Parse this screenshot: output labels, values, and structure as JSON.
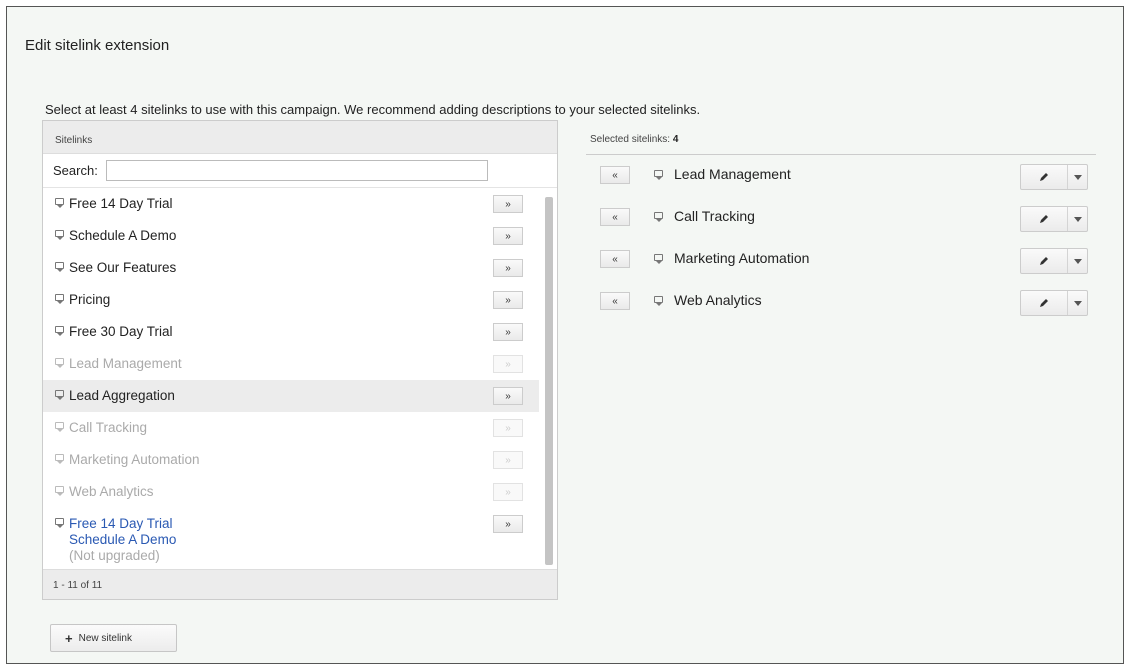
{
  "dialog": {
    "title": "Edit sitelink extension",
    "instructions": "Select at least 4 sitelinks to use with this campaign. We recommend adding descriptions to your selected sitelinks."
  },
  "sitelinks": {
    "header": "Sitelinks",
    "search_label": "Search:",
    "search_value": "",
    "add_glyph": "»",
    "items": [
      {
        "label": "Free 14 Day Trial",
        "state": "available"
      },
      {
        "label": "Schedule A Demo",
        "state": "available"
      },
      {
        "label": "See Our Features",
        "state": "available"
      },
      {
        "label": "Pricing",
        "state": "available"
      },
      {
        "label": "Free 30 Day Trial",
        "state": "available"
      },
      {
        "label": "Lead Management",
        "state": "selected"
      },
      {
        "label": "Lead Aggregation",
        "state": "available"
      },
      {
        "label": "Call Tracking",
        "state": "selected"
      },
      {
        "label": "Marketing Automation",
        "state": "selected"
      },
      {
        "label": "Web Analytics",
        "state": "selected"
      }
    ],
    "multi_item": {
      "line1": "Free 14 Day Trial",
      "line2": "Schedule A Demo",
      "note": "(Not upgraded)"
    },
    "pagination": "1 - 11 of 11",
    "new_button": "New sitelink"
  },
  "selected": {
    "header_label": "Selected sitelinks:",
    "count": "4",
    "remove_glyph": "«",
    "items": [
      {
        "label": "Lead Management"
      },
      {
        "label": "Call Tracking"
      },
      {
        "label": "Marketing Automation"
      },
      {
        "label": "Web Analytics"
      }
    ]
  },
  "colors": {
    "link_blue": "#2a59b3",
    "disabled_text": "#aaaaaa",
    "panel_header": "#ececec"
  },
  "icons": [
    "comment-bubble-icon",
    "pencil-icon",
    "caret-down-icon",
    "plus-icon"
  ]
}
